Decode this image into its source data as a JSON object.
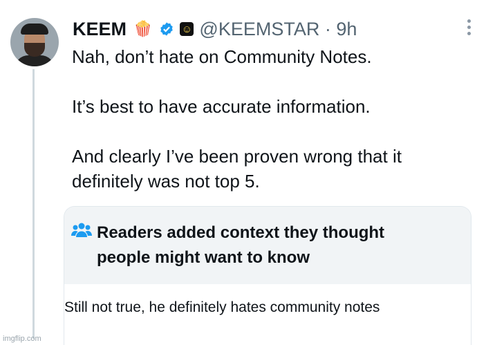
{
  "tweet": {
    "display_name": "KEEM",
    "name_emoji": "🍿",
    "verified_icon": "verified-badge-icon",
    "handle_emoji": "☺",
    "handle": "@KEEMSTAR · 9h",
    "lines": [
      "Nah, don’t hate on Community Notes.",
      "It’s best to have accurate information.",
      "And clearly I’ve been proven wrong that it",
      "definitely was not top 5."
    ]
  },
  "community_note": {
    "icon": "people-icon",
    "title_line1": "Readers added context they thought",
    "title_line2": "people might want to know",
    "body": "Still not true, he definitely hates community notes"
  },
  "watermark": "imgflip.com",
  "colors": {
    "accent": "#1d9bf0",
    "secondary_text": "#536471",
    "note_bg": "#f1f4f6"
  }
}
